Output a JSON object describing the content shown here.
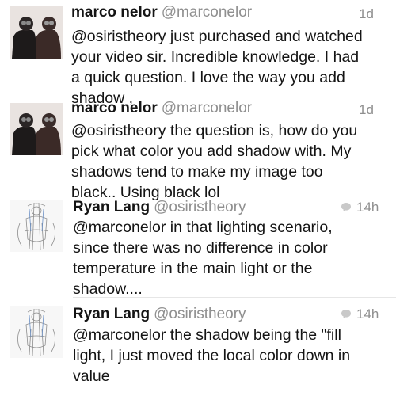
{
  "tweets": [
    {
      "name": "marco nelor",
      "handle": "@marconelor",
      "time": "1d",
      "lines": [
        "@osiristheory just purchased and watched",
        "your video sir. Incredible knowledge. I had",
        "a quick question. I love the way you add",
        "shadow ,"
      ],
      "avatar": "dark-figures-avatar"
    },
    {
      "name": "marco nelor",
      "handle": "@marconelor",
      "time": "1d",
      "lines": [
        "@osiristheory the question is, how do you",
        "pick what color you add shadow with. My",
        "shadows tend to make my image too",
        "black.. Using black lol"
      ],
      "avatar": "dark-figures-avatar"
    },
    {
      "name": "Ryan Lang",
      "handle": "@osiristheory",
      "time": "14h",
      "lines": [
        "@marconelor in that lighting scenario,",
        "since there was no difference in color",
        "temperature in the main light or the",
        "shadow...."
      ],
      "avatar": "sketch-figure-avatar"
    },
    {
      "name": "Ryan Lang",
      "handle": "@osiristheory",
      "time": "14h",
      "lines": [
        "@marconelor the shadow being the \"fill",
        "light, I just moved the local color down in",
        "value"
      ],
      "avatar": "sketch-figure-avatar"
    }
  ],
  "colors": {
    "text": "#141414",
    "muted": "#8f8f8f",
    "divider": "#e6e6e6"
  },
  "icons": {
    "reply": "speech-bubble-icon"
  }
}
